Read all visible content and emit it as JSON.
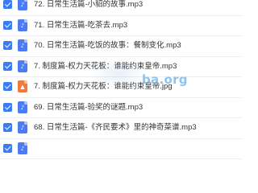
{
  "files": [
    {
      "name": "72. 日常生活篇-小貂的故事.mp3",
      "type": "audio",
      "checked": true,
      "icon": "music-file-icon"
    },
    {
      "name": "71. 日常生活篇-吃茶去.mp3",
      "type": "audio",
      "checked": true,
      "icon": "music-file-icon"
    },
    {
      "name": "70. 日常生活篇-吃饭的故事：餐制变化.mp3",
      "type": "audio",
      "checked": true,
      "icon": "music-file-icon"
    },
    {
      "name": "7. 制度篇-权力天花板：谁能约束皇帝.mp3",
      "type": "audio",
      "checked": true,
      "icon": "music-file-icon"
    },
    {
      "name": "7. 制度篇-权力天花板：谁能约束皇帝.jpg",
      "type": "image",
      "checked": true,
      "icon": "image-file-icon"
    },
    {
      "name": "69. 日常生活篇-验奖的谜题.mp3",
      "type": "audio",
      "checked": true,
      "icon": "music-file-icon"
    },
    {
      "name": "68. 日常生活篇-《齐民要术》里的神奇菜谱.mp3",
      "type": "audio",
      "checked": true,
      "icon": "music-file-icon"
    },
    {
      "name": "",
      "type": "audio",
      "checked": true,
      "icon": "music-file-icon"
    }
  ],
  "watermark": "ba.org",
  "colors": {
    "checkbox": "#3a7bf6",
    "audio_icon": "#4b7cf5",
    "image_icon": "#f0793c"
  }
}
